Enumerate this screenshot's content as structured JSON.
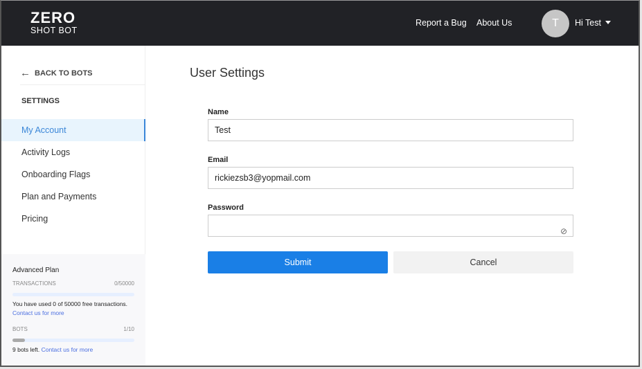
{
  "header": {
    "logo_top": "ZERO",
    "logo_bottom": "SHOT BOT",
    "links": [
      "Report a Bug",
      "About Us"
    ],
    "avatar_initial": "T",
    "greeting": "Hi Test"
  },
  "sidebar": {
    "back": "BACK TO BOTS",
    "section": "SETTINGS",
    "items": [
      "My Account",
      "Activity Logs",
      "Onboarding Flags",
      "Plan and Payments",
      "Pricing"
    ],
    "active": "My Account"
  },
  "plan": {
    "name": "Advanced Plan",
    "transactions_label": "TRANSACTIONS",
    "transactions_value": "0/50000",
    "transactions_fraction": 0,
    "transactions_text": "You have used 0 of 50000 free transactions.",
    "contact": "Contact us for more",
    "bots_label": "BOTS",
    "bots_value": "1/10",
    "bots_fraction": 0.1,
    "bots_text": "9 bots left.",
    "bots_contact": "Contact us for more"
  },
  "form": {
    "title": "User Settings",
    "name_label": "Name",
    "name_value": "Test",
    "email_label": "Email",
    "email_value": "rickiezsb3@yopmail.com",
    "password_label": "Password",
    "password_value": "",
    "submit": "Submit",
    "cancel": "Cancel"
  },
  "colors": {
    "primary": "#1a7fe6",
    "header": "#212226",
    "active": "#3a86d8"
  }
}
